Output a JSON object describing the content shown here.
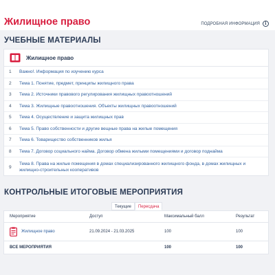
{
  "header": {
    "course_title": "Жилищное право",
    "more_info_label": "ПОДРОБНАЯ ИНФОРМАЦИЯ"
  },
  "materials": {
    "section_title": "УЧЕБНЫЕ МАТЕРИАЛЫ",
    "course_label": "Жилищное право",
    "items": [
      {
        "num": "1",
        "text": "Важно!. Информация по изучению курса"
      },
      {
        "num": "2",
        "text": "Тема 1. Понятие, предмет, принципы жилищного права"
      },
      {
        "num": "3",
        "text": "Тема 2. Источники правового регулирования жилищных правоотношений"
      },
      {
        "num": "4",
        "text": "Тема 3. Жилищные правоотношения. Объекты жилищных правоотношений"
      },
      {
        "num": "5",
        "text": "Тема 4. Осуществление и защита жилищных прав"
      },
      {
        "num": "6",
        "text": "Тема 5. Право собственности и другие вещные права на жилые помещения"
      },
      {
        "num": "7",
        "text": "Тема 6. Товарищество собственников жилья"
      },
      {
        "num": "8",
        "text": "Тема 7. Договор социального найма. Договор обмена жилыми помещениями и договор поднайма"
      },
      {
        "num": "9",
        "text": "Тема 8. Права на жилые помещения в домах специализированного жилищного фонда, в домах жилищных и жилищно-строительных кооперативов"
      }
    ]
  },
  "events": {
    "section_title": "КОНТРОЛЬНЫЕ ИТОГОВЫЕ МЕРОПРИЯТИЯ",
    "tabs": [
      "Текущие",
      "Пересдача"
    ],
    "active_tab": "Пересдача",
    "columns": [
      "Мероприятие",
      "Доступ",
      "Максимальный балл",
      "Результат"
    ],
    "rows": [
      {
        "name": "Жилищное право",
        "access": "21.09.2024 - 21.03.2025",
        "max_score": "100",
        "result": "100"
      }
    ],
    "total": {
      "label": "ВСЕ МЕРОПРИЯТИЯ",
      "max_score": "100",
      "result": "100"
    }
  },
  "colors": {
    "accent": "#d81e3f",
    "link": "#2f5f9e",
    "text": "#2b3b55",
    "background": "#f1f2f5"
  }
}
